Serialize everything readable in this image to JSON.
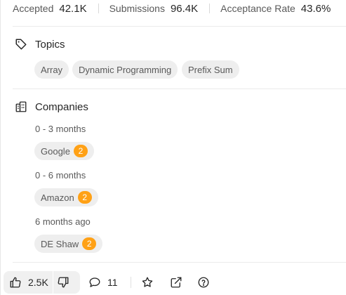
{
  "stats": [
    {
      "label": "Accepted",
      "value": "42.1K"
    },
    {
      "label": "Submissions",
      "value": "96.4K"
    },
    {
      "label": "Acceptance Rate",
      "value": "43.6%"
    }
  ],
  "topics": {
    "title": "Topics",
    "icon": "tag-icon",
    "tags": [
      "Array",
      "Dynamic Programming",
      "Prefix Sum"
    ]
  },
  "companies": {
    "title": "Companies",
    "icon": "building-icon",
    "groups": [
      {
        "period": "0 - 3 months",
        "company": "Google",
        "count": "2"
      },
      {
        "period": "0 - 6 months",
        "company": "Amazon",
        "count": "2"
      },
      {
        "period": "6 months ago",
        "company": "DE Shaw",
        "count": "2"
      }
    ]
  },
  "footer": {
    "likes": "2.5K",
    "comments": "11",
    "icons": [
      "thumbs-up-icon",
      "thumbs-down-icon",
      "comment-icon",
      "star-icon",
      "share-icon",
      "help-icon"
    ]
  },
  "colors": {
    "badge": "#ffa116",
    "chip": "#eeeeee",
    "muted_text": "#595959"
  }
}
